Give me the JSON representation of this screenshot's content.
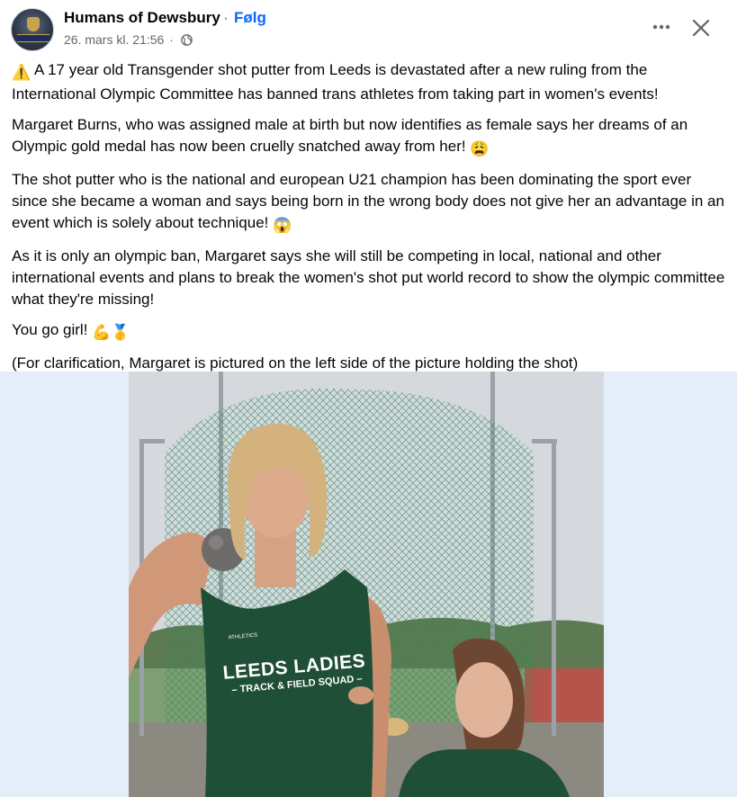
{
  "post": {
    "author": "Humans of Dewsbury",
    "separator": "·",
    "follow_label": "Følg",
    "timestamp": "26. mars kl. 21:56",
    "meta_separator": "·",
    "audience_icon": "globe-icon",
    "more_icon": "more-options-icon",
    "close_icon": "close-icon"
  },
  "content": {
    "paragraph1": {
      "emoji": "⚠️",
      "text": " A 17 year old Transgender shot putter from Leeds is devastated after a new ruling from the International Olympic Committee has banned trans athletes from taking part in women's events!"
    },
    "paragraph2": {
      "text": "Margaret Burns, who was assigned male at birth but now identifies as female says her dreams of an Olympic gold medal has now been cruelly snatched away from her! ",
      "emoji": "😩"
    },
    "paragraph3": {
      "text": "The shot putter who is the national and european U21 champion has been dominating the sport ever since she became a woman and says being born in the wrong body does not give her an advantage in an event which is solely about technique! ",
      "emoji": "😱"
    },
    "paragraph4": {
      "text": "As it is only an olympic ban, Margaret says she will still be competing in local, national and other international events and plans to break the women's shot put world record to show the olympic committee what they're missing!"
    },
    "paragraph5": {
      "text": "You go girl! ",
      "emoji": "💪🥇"
    },
    "paragraph6": {
      "text": "(For clarification, Margaret is pictured on the left side of the picture holding the shot)"
    }
  },
  "photo": {
    "shirt_main": "LEEDS LADIES",
    "shirt_sub": "– TRACK & FIELD SQUAD –",
    "shirt_logo": "ATHLETICS"
  },
  "colors": {
    "link": "#0866ff",
    "secondary_text": "#65676b",
    "photo_background": "#e4eef8",
    "vest_green": "#1f4f37"
  }
}
